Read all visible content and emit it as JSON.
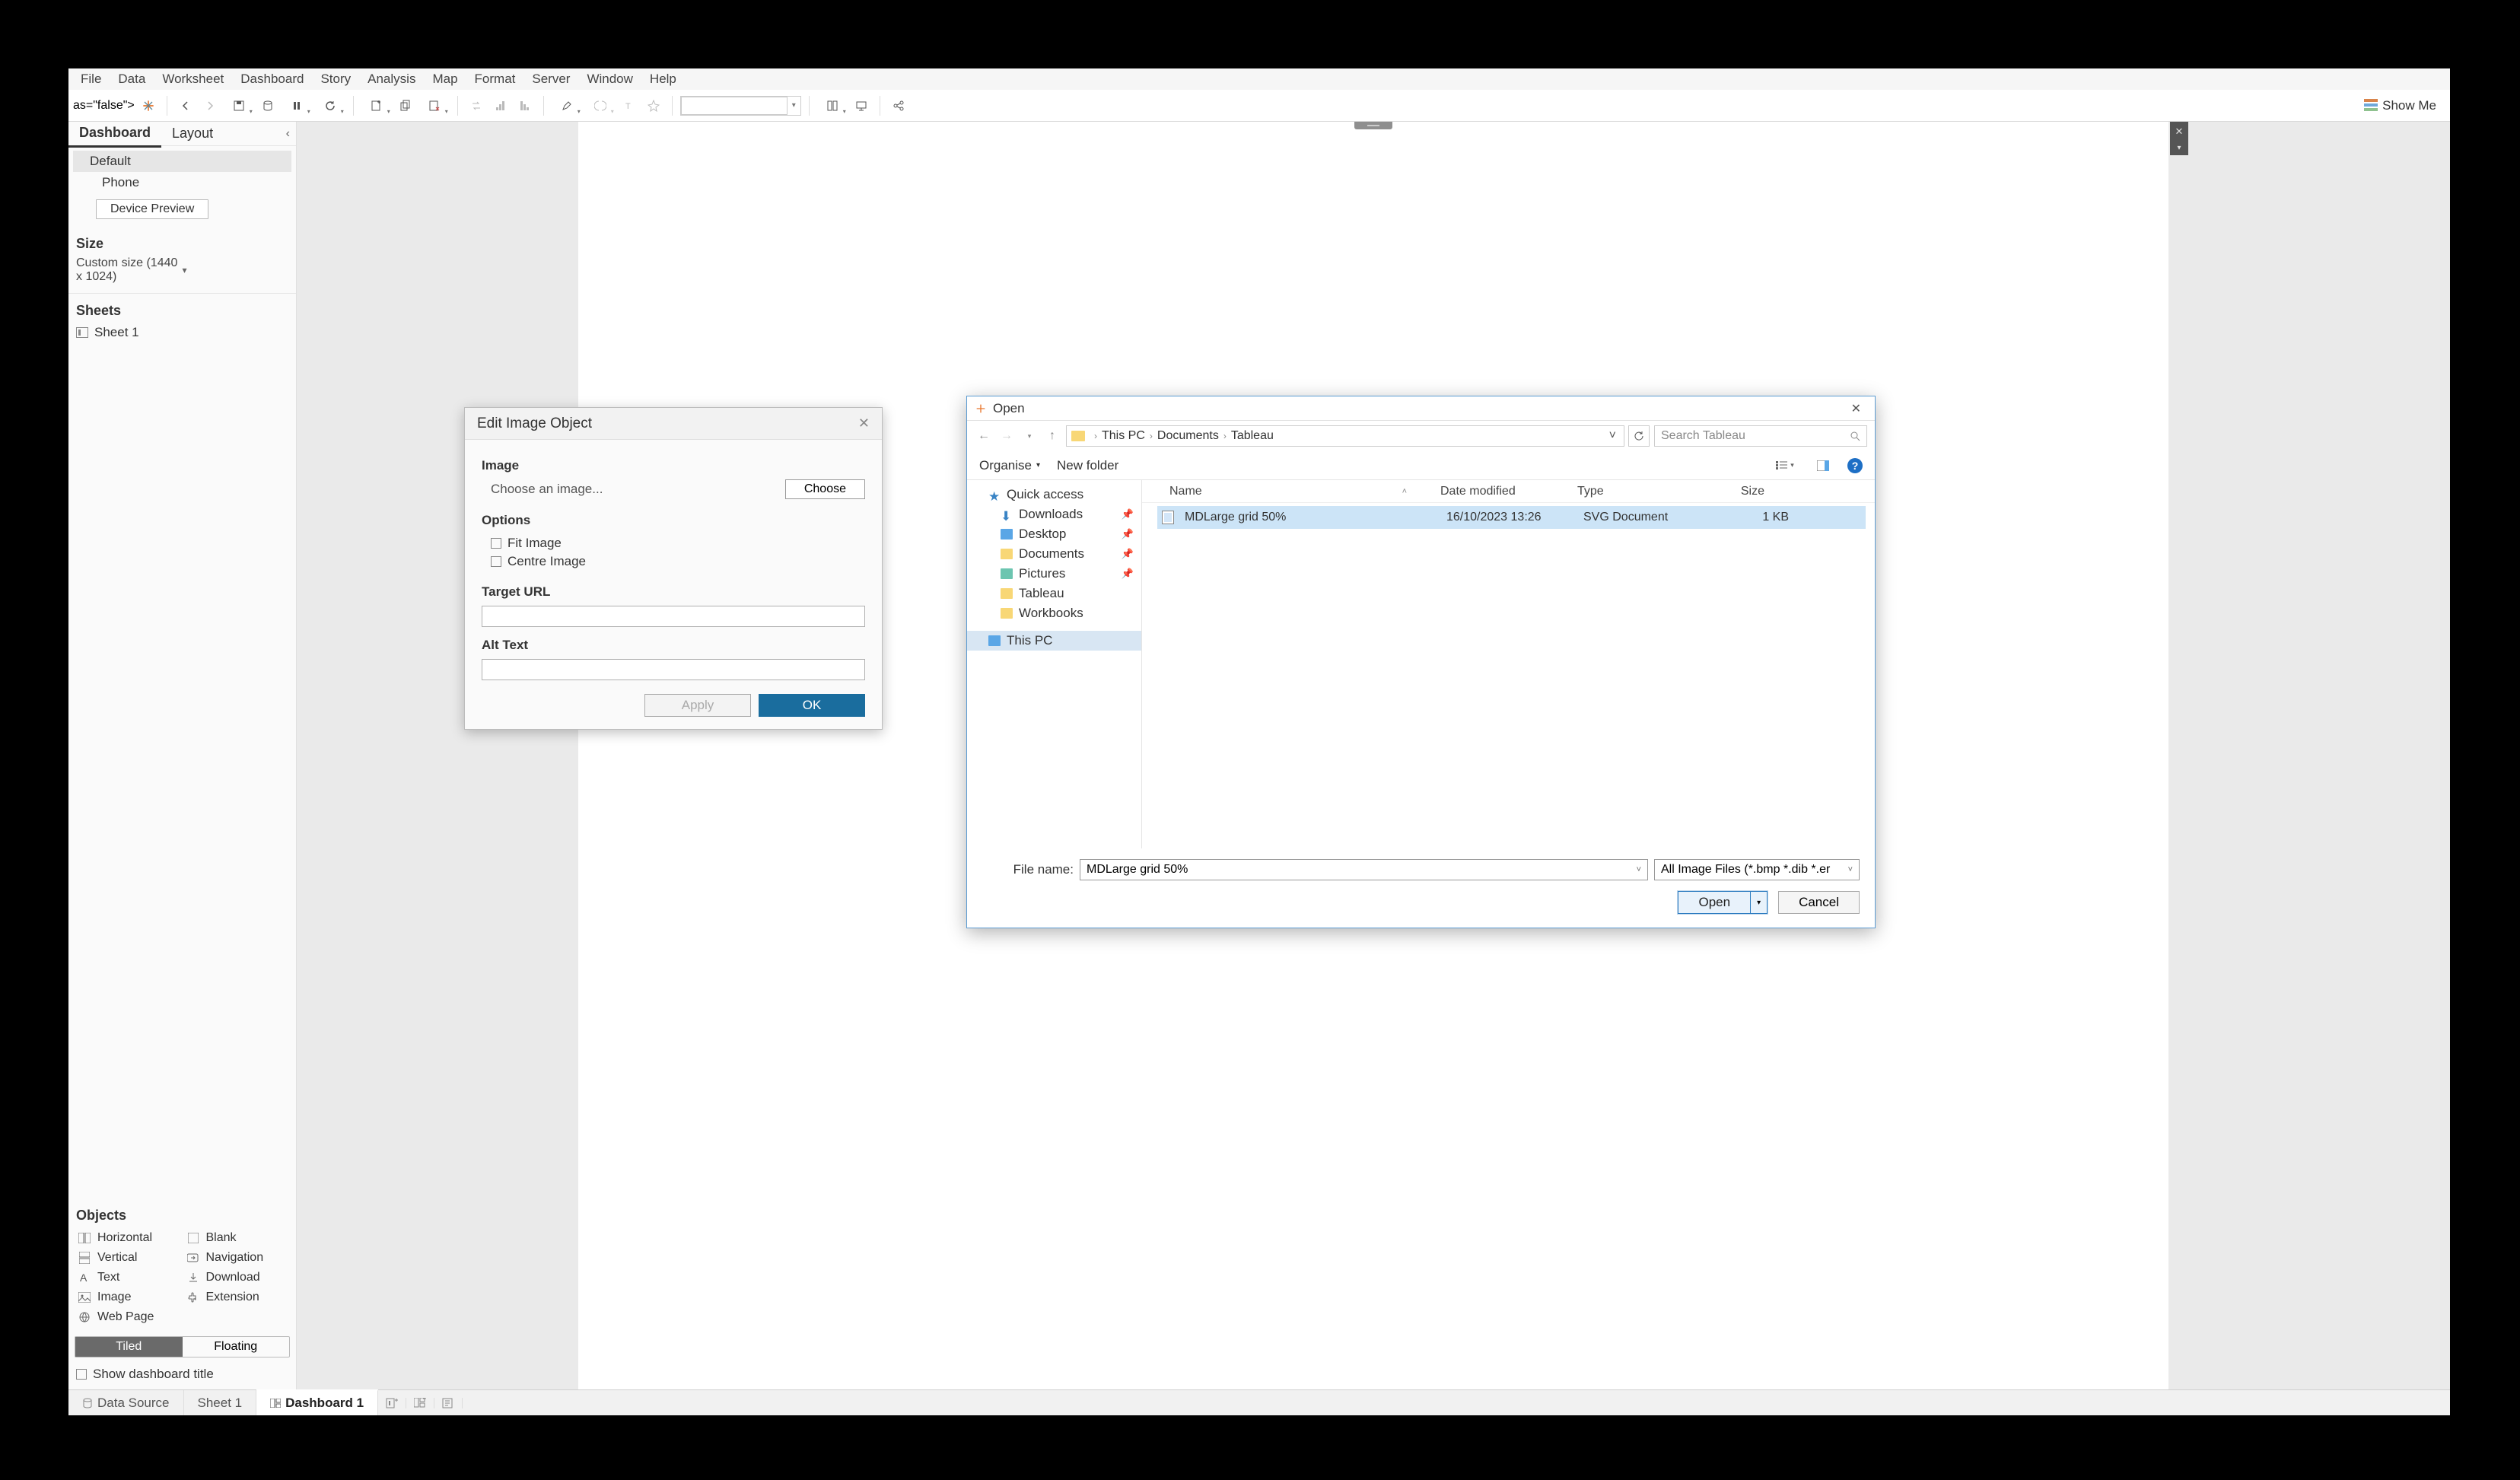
{
  "menubar": [
    "File",
    "Data",
    "Worksheet",
    "Dashboard",
    "Story",
    "Analysis",
    "Map",
    "Format",
    "Server",
    "Window",
    "Help"
  ],
  "toolbar": {
    "showme": "Show Me"
  },
  "sidebar": {
    "tabs": {
      "dashboard": "Dashboard",
      "layout": "Layout"
    },
    "device": {
      "default": "Default",
      "phone": "Phone",
      "preview_btn": "Device Preview"
    },
    "size": {
      "header": "Size",
      "value": "Custom size (1440 x 1024)"
    },
    "sheets": {
      "header": "Sheets",
      "items": [
        "Sheet 1"
      ]
    },
    "objects": {
      "header": "Objects",
      "items": [
        "Horizontal",
        "Blank",
        "Vertical",
        "Navigation",
        "Text",
        "Download",
        "Image",
        "Extension",
        "Web Page"
      ]
    },
    "layout_toggle": {
      "tiled": "Tiled",
      "floating": "Floating"
    },
    "show_title": "Show dashboard title"
  },
  "bottom_tabs": {
    "data_source": "Data Source",
    "sheet1": "Sheet 1",
    "dashboard1": "Dashboard 1"
  },
  "edit_dialog": {
    "title": "Edit Image Object",
    "section_image": "Image",
    "choose_placeholder": "Choose an image...",
    "choose_btn": "Choose",
    "section_options": "Options",
    "fit_image": "Fit Image",
    "centre_image": "Centre Image",
    "target_url": "Target URL",
    "alt_text": "Alt Text",
    "apply": "Apply",
    "ok": "OK"
  },
  "open_dialog": {
    "title": "Open",
    "breadcrumb": [
      "This PC",
      "Documents",
      "Tableau"
    ],
    "search_placeholder": "Search Tableau",
    "organise": "Organise",
    "new_folder": "New folder",
    "tree": {
      "quick_access": "Quick access",
      "downloads": "Downloads",
      "desktop": "Desktop",
      "documents": "Documents",
      "pictures": "Pictures",
      "tableau": "Tableau",
      "workbooks": "Workbooks",
      "this_pc": "This PC"
    },
    "columns": {
      "name": "Name",
      "date": "Date modified",
      "type": "Type",
      "size": "Size"
    },
    "files": [
      {
        "name": "MDLarge grid 50%",
        "date": "16/10/2023 13:26",
        "type": "SVG Document",
        "size": "1 KB"
      }
    ],
    "filename_label": "File name:",
    "filename_value": "MDLarge grid 50%",
    "filter": "All Image Files (*.bmp *.dib *.er",
    "open_btn": "Open",
    "cancel_btn": "Cancel"
  }
}
